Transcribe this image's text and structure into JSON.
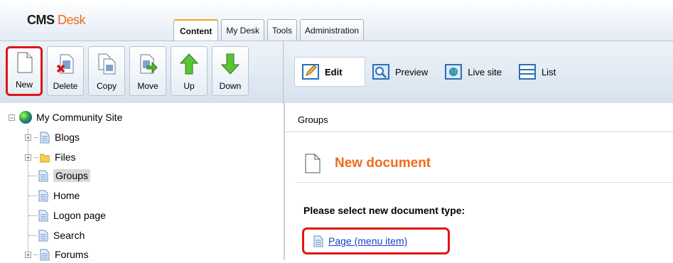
{
  "app": {
    "logo_primary": "CMS",
    "logo_secondary": "Desk"
  },
  "tabs": [
    {
      "label": "Content",
      "active": true
    },
    {
      "label": "My Desk",
      "active": false
    },
    {
      "label": "Tools",
      "active": false
    },
    {
      "label": "Administration",
      "active": false
    }
  ],
  "actions": [
    {
      "label": "New",
      "icon": "new-document-icon",
      "highlighted": true
    },
    {
      "label": "Delete",
      "icon": "delete-document-icon"
    },
    {
      "label": "Copy",
      "icon": "copy-document-icon"
    },
    {
      "label": "Move",
      "icon": "move-document-icon"
    },
    {
      "label": "Up",
      "icon": "arrow-up-icon"
    },
    {
      "label": "Down",
      "icon": "arrow-down-icon"
    }
  ],
  "view_modes": [
    {
      "label": "Edit",
      "icon": "edit-icon",
      "active": true
    },
    {
      "label": "Preview",
      "icon": "preview-icon"
    },
    {
      "label": "Live site",
      "icon": "live-site-icon"
    },
    {
      "label": "List",
      "icon": "list-icon"
    }
  ],
  "tree": {
    "root": "My Community Site",
    "items": [
      {
        "label": "Blogs",
        "expandable": true,
        "icon": "page-icon"
      },
      {
        "label": "Files",
        "expandable": true,
        "icon": "folder-icon"
      },
      {
        "label": "Groups",
        "expandable": false,
        "icon": "page-icon",
        "selected": true
      },
      {
        "label": "Home",
        "expandable": false,
        "icon": "page-icon"
      },
      {
        "label": "Logon page",
        "expandable": false,
        "icon": "page-icon"
      },
      {
        "label": "Search",
        "expandable": false,
        "icon": "page-icon"
      },
      {
        "label": "Forums",
        "expandable": true,
        "icon": "page-icon"
      }
    ]
  },
  "breadcrumb": "Groups",
  "content": {
    "title": "New document",
    "prompt": "Please select new document type:",
    "document_types": [
      {
        "label": "Page (menu item)",
        "icon": "page-icon"
      }
    ]
  },
  "colors": {
    "accent": "#ef6b1c",
    "highlight": "#e01515",
    "link": "#1b3fcf"
  }
}
